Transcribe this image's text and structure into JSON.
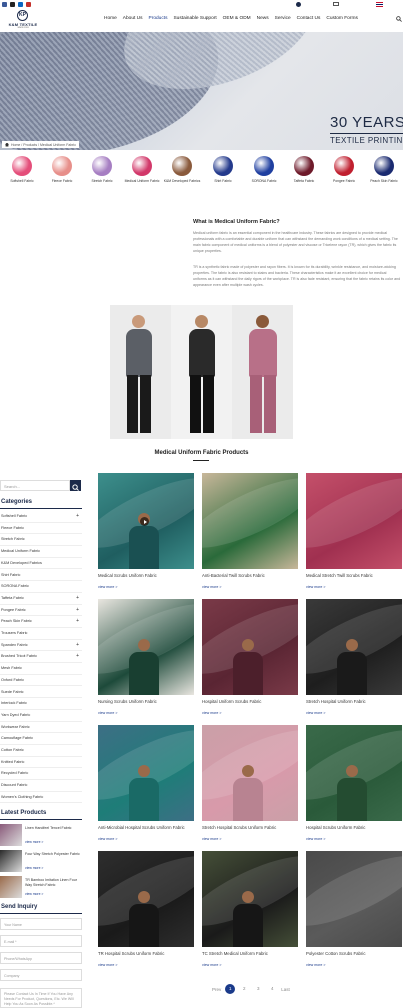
{
  "nav": {
    "items": [
      "Home",
      "About Us",
      "Products",
      "Sustainable Support",
      "OEM & ODM",
      "News",
      "Service",
      "Contact Us",
      "Custom Forms"
    ],
    "active_index": 2
  },
  "logo": {
    "mark": "KP",
    "text": "K&M TEXTILE",
    "tagline": "SINCE 1993"
  },
  "banner": {
    "title": "30 YEARS",
    "subtitle": "TEXTILE PRINTING"
  },
  "breadcrumb": "Home / Products / Medical Uniform Fabric",
  "categories": [
    {
      "label": "Softshell Fabric",
      "color": "#e44e7a"
    },
    {
      "label": "Fleece Fabric",
      "color": "#e78f8a"
    },
    {
      "label": "Stretch Fabric",
      "color": "#a67ec2"
    },
    {
      "label": "Medical Uniform Fabric",
      "color": "#d2386a"
    },
    {
      "label": "K&M Developed Fabrics",
      "color": "#8a5a3c"
    },
    {
      "label": "Shirt Fabric",
      "color": "#243a8c"
    },
    {
      "label": "SORONA Fabric",
      "color": "#1f3fa0"
    },
    {
      "label": "Taffeta Fabric",
      "color": "#6e1a2a"
    },
    {
      "label": "Pongee Fabric",
      "color": "#c01f2f"
    },
    {
      "label": "Peach Skin Fabric",
      "color": "#1a2a70"
    }
  ],
  "intro": {
    "title": "What is Medical Uniform Fabric?",
    "p1": "Medical uniform fabric is an essential component in the healthcare industry. These fabrics are designed to provide medical professionals with a comfortable and durable uniform that can withstand the demanding work conditions of a medical setting. The main fabric component of medical uniforms is a blend of polyester and viscose or Tricelene rayon (TR), which gives the fabric its unique properties.",
    "p2": "TR is a synthetic fabric made of polyester and rayon fibers. It is known for its durability, wrinkle resistance, and moisture-wicking properties. The fabric is also resistant to stains and bacteria. These characteristics make it an excellent choice for medical uniforms as it can withstand the daily rigors of the workplace. TR is also fade resistant, ensuring that the fabric retains its color and appearance even after multiple wash cycles."
  },
  "products_section_title": "Medical Uniform Fabric Products",
  "sidebar": {
    "search_placeholder": "Search...",
    "categories_title": "Categories",
    "categories": [
      {
        "label": "Softshell Fabric",
        "expand": "+"
      },
      {
        "label": "Fleece Fabric",
        "expand": ""
      },
      {
        "label": "Stretch Fabric",
        "expand": ""
      },
      {
        "label": "Medical Uniform Fabric",
        "expand": ""
      },
      {
        "label": "K&M Developed Fabrics",
        "expand": ""
      },
      {
        "label": "Shirt Fabric",
        "expand": ""
      },
      {
        "label": "SORONA Fabric",
        "expand": ""
      },
      {
        "label": "Taffeta Fabric",
        "expand": "+"
      },
      {
        "label": "Pongee Fabric",
        "expand": "+"
      },
      {
        "label": "Peach Skin Fabric",
        "expand": "+"
      },
      {
        "label": "Trousers Fabric",
        "expand": ""
      },
      {
        "label": "Spandex Fabric",
        "expand": "+"
      },
      {
        "label": "Brushed Tricot Fabric",
        "expand": "+"
      },
      {
        "label": "Mesh Fabric",
        "expand": ""
      },
      {
        "label": "Oxford Fabric",
        "expand": ""
      },
      {
        "label": "Suede Fabric",
        "expand": ""
      },
      {
        "label": "Interlock Fabric",
        "expand": ""
      },
      {
        "label": "Yarn Dyed Fabric",
        "expand": ""
      },
      {
        "label": "Workwear Fabric",
        "expand": ""
      },
      {
        "label": "Camouflage Fabric",
        "expand": ""
      },
      {
        "label": "Cotton Fabric",
        "expand": ""
      },
      {
        "label": "Knitted Fabric",
        "expand": ""
      },
      {
        "label": "Recycled Fabric",
        "expand": ""
      },
      {
        "label": "Discount Fabric",
        "expand": ""
      },
      {
        "label": "Women's Clothing Fabric",
        "expand": ""
      }
    ],
    "latest_title": "Latest Products",
    "latest": [
      {
        "name": "Linen Handfeel Tencel Fabric",
        "more": "view more >",
        "color": "#8a5a7a"
      },
      {
        "name": "Four Way Stretch Polyester Fabric",
        "more": "view more >",
        "color": "#2a2a2a"
      },
      {
        "name": "TR Bamboo Imitation Linen Four Way Stretch Fabric",
        "more": "view more >",
        "color": "#9a6a4a"
      }
    ],
    "inquiry_title": "Send Inquiry",
    "inquiry_fields": [
      "Your Name",
      "E-mail *",
      "Phone/WhatsApp",
      "Company"
    ],
    "inquiry_message": "Please Contact Us In Time If You Have Any Needs For Product, Questions, Etc. We Will Help You As Soon As Possible.*"
  },
  "products": [
    {
      "name": "Medical Scrubs Uniform Fabric",
      "more": "view more >",
      "bg": "#3d8f8c",
      "accent": "#1f5e60",
      "person": true,
      "video": true
    },
    {
      "name": "Anti-Bacterial Twill Scrubs Fabric",
      "more": "view more >",
      "bg": "#c8b79a",
      "accent": "#2a6a3a",
      "person": false,
      "video": false
    },
    {
      "name": "Medical Stretch Twill Scrubs Fabric",
      "more": "view more >",
      "bg": "#c4506a",
      "accent": "#a03050",
      "person": false,
      "video": false
    },
    {
      "name": "Nursing Scrubs Uniform Fabric",
      "more": "view more >",
      "bg": "#e9e6e0",
      "accent": "#1d4a3a",
      "person": true,
      "video": false
    },
    {
      "name": "Hospital Uniform Scrubs Fabric",
      "more": "view more >",
      "bg": "#7a3a48",
      "accent": "#5a2533",
      "person": true,
      "video": false
    },
    {
      "name": "Stretch Hospital Uniform Fabric",
      "more": "view more >",
      "bg": "#3a3a3a",
      "accent": "#1e1e1e",
      "person": true,
      "video": false
    },
    {
      "name": "Anti-Microbial Hospital Scrubs Uniform Fabric",
      "more": "view more >",
      "bg": "#3d6f85",
      "accent": "#1e7d78",
      "person": true,
      "video": false
    },
    {
      "name": "Stretch Hospital Scrubs Uniform Fabric",
      "more": "view more >",
      "bg": "#caa0a8",
      "accent": "#d89aaa",
      "person": true,
      "video": false
    },
    {
      "name": "Hospital Scrubs Uniform Fabric",
      "more": "view more >",
      "bg": "#3a6a4a",
      "accent": "#2a5a3a",
      "person": true,
      "video": false
    },
    {
      "name": "TR Hospital Scrubs Uniform Fabric",
      "more": "view more >",
      "bg": "#2e2e2e",
      "accent": "#1a1a1a",
      "person": true,
      "video": false
    },
    {
      "name": "TC Stretch Medical Uniform Fabric",
      "more": "view more >",
      "bg": "#454f38",
      "accent": "#1a1a1a",
      "person": true,
      "video": false
    },
    {
      "name": "Polyester Cotton Scrubs Fabric",
      "more": "view more >",
      "bg": "#4a4a4a",
      "accent": "#5a5a5a",
      "person": false,
      "video": false
    }
  ],
  "pagination": {
    "prev": "Prev",
    "pages": [
      "1",
      "2",
      "3",
      "4"
    ],
    "last": "Last",
    "active": "1"
  }
}
